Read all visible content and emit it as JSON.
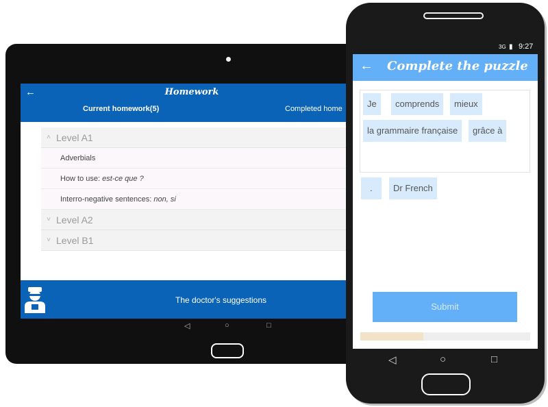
{
  "tablet": {
    "appbar": {
      "back_icon": "arrow-left-icon",
      "title": "Homework",
      "tabs": [
        {
          "label": "Current homework(5)",
          "selected": true
        },
        {
          "label": "Completed home"
        }
      ]
    },
    "levels": [
      {
        "name": "Level A1",
        "expanded": true,
        "chevron": "˄",
        "items": [
          {
            "text": "Adverbials",
            "em": ""
          },
          {
            "text": "How to use: ",
            "em": "est-ce que ?"
          },
          {
            "text": "Interro-negative sentences: ",
            "em": "non, si"
          }
        ]
      },
      {
        "name": "Level A2",
        "expanded": false,
        "chevron": "˅"
      },
      {
        "name": "Level B1",
        "expanded": false,
        "chevron": "˅"
      }
    ],
    "bottom": {
      "icon": "doctor-icon",
      "label": "The doctor's suggestions"
    },
    "nav": {
      "back": "◁",
      "home": "○",
      "recents": "□"
    }
  },
  "phone": {
    "status": {
      "signal": "3G",
      "battery": "▮",
      "time": "9:27"
    },
    "appbar": {
      "back_icon": "arrow-left-icon",
      "title": "Complete the puzzle"
    },
    "answer_chips": [
      "Je",
      "comprends",
      "mieux",
      "la grammaire française",
      "grâce à"
    ],
    "choice_chips": [
      ".",
      "Dr French"
    ],
    "submit_label": "Submit",
    "progress": 0.37,
    "nav": {
      "back": "◁",
      "home": "○",
      "recents": "□"
    }
  },
  "colors": {
    "tablet_accent": "#0a63b7",
    "phone_accent": "#64b0f8",
    "chip": "#d8ebfc",
    "progress_fill": "#f2e2c7"
  }
}
